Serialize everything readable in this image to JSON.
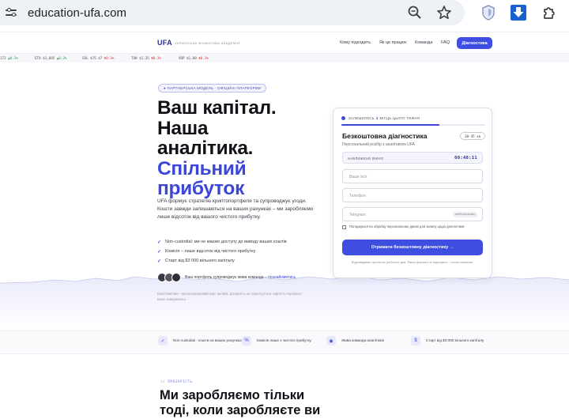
{
  "browser": {
    "url": "education-ufa.com",
    "icons": [
      "site-info-icon",
      "zoom-icon",
      "star-icon",
      "shield-extension-icon",
      "download-icon",
      "extensions-icon"
    ]
  },
  "site": {
    "logo": "UFA",
    "logo_subtitle": "УКРАЇНСЬКА ФІНАНСОВА АКАДЕМІЯ",
    "nav": [
      "Кому підходить",
      "Як це працює",
      "Команда",
      "FAQ"
    ],
    "cta": "Діагностика"
  },
  "ticker": [
    {
      "sym": "173",
      "chg": "▲0.3%",
      "dir": "up"
    },
    {
      "sym": "ETH",
      "price": "$1,885",
      "chg": "▲0.3%",
      "dir": "up"
    },
    {
      "sym": "SOL",
      "price": "$75.47",
      "chg": "▼0.3%",
      "dir": "dn"
    },
    {
      "sym": "TON",
      "price": "$1.35",
      "chg": "▼0.3%",
      "dir": "dn"
    },
    {
      "sym": "XRP",
      "price": "$1.00",
      "chg": "▼0.3%",
      "dir": "dn"
    }
  ],
  "hero": {
    "badge": "● ПАРТНЕРСЬКА МОДЕЛЬ · ОФІЦІЙНІ ПЛАТФОРМИ",
    "title_line1": "Ваш капітал.",
    "title_line2": "Наша",
    "title_line3": "аналітика.",
    "title_accent1": "Спільний",
    "title_accent2": "прибуток",
    "lead": "UFA формує стратегію криптопортфеля та супроводжує угоди. Кошти завжди залишаються на ваших рахунках – ми заробляємо лише відсоток від вашого чистого прибутку.",
    "checks": [
      "Non-custodial: ми не маємо доступу до виводу ваших коштів",
      "Комісія – лише відсоток від чистого прибутку",
      "Старт від $3 000 вільного капіталу"
    ],
    "avatars_text": "Ваш портфель супроводжує жива команда –",
    "avatars_link": "познайомитись",
    "disclaimer": "Криптоактиви – високоризиковий клас активів. Дохідність не гарантується, вартість портфеля може знижуватись."
  },
  "form": {
    "top_label_pre": "ЗАЛИШИЛОСЬ",
    "top_label_num": "3",
    "top_label_post": "МІСЦЬ ЦЬОГО ТИЖНЯ",
    "progress": 0.68,
    "title": "Безкоштовна діагностика",
    "timer_pill": "30-45 хв",
    "subtitle": "Персональний розбір з аналітиком UFA",
    "countdown_label": "НАБЛИЖЕНЕ ВІКНО",
    "countdown_value": "00:48:11",
    "name_placeholder": "Ваше ім'я",
    "phone_placeholder": "Телефон",
    "telegram_placeholder": "Telegram",
    "telegram_tag": "необов'язково",
    "consent": "Погоджуюся на обробку персональних даних для запису щодо діагностики",
    "submit": "Отримати безкоштовну діагностику →",
    "note": "Відповідаємо протягом робочого дня. Якщо формат не підходить – чесно скажемо."
  },
  "features": [
    {
      "icon": "check-icon",
      "glyph": "✓",
      "text": "Non-custodial - кошти на ваших рахунках"
    },
    {
      "icon": "percent-icon",
      "glyph": "%",
      "text": "Комісія лише з чистого прибутку"
    },
    {
      "icon": "team-icon",
      "glyph": "◉",
      "text": "Жива команда аналітиків"
    },
    {
      "icon": "dollar-icon",
      "glyph": "$",
      "text": "Старт від $3 000 вільного капіталу"
    }
  ],
  "section": {
    "kicker": "// ПРОЗОРІСТЬ",
    "title_line1": "Ми заробляємо тільки",
    "title_line2": "тоді, коли заробляєте ви"
  }
}
